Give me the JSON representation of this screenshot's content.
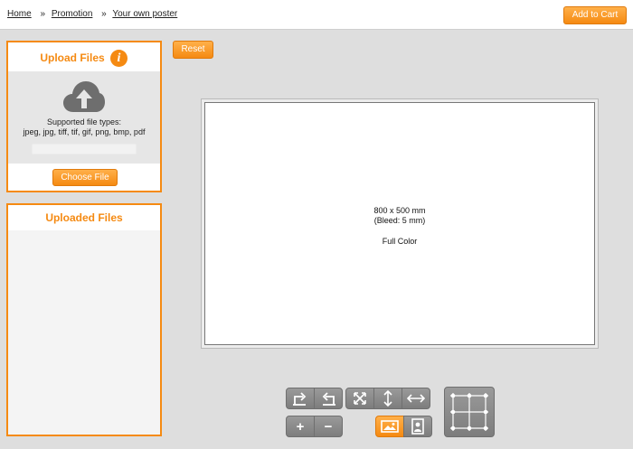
{
  "breadcrumb": {
    "items": [
      {
        "label": "Home"
      },
      {
        "label": "Promotion"
      },
      {
        "label": "Your own poster"
      }
    ],
    "separator": "»"
  },
  "header": {
    "add_to_cart": "Add to Cart"
  },
  "upload": {
    "title": "Upload Files",
    "info_glyph": "i",
    "supported_label": "Supported file types:",
    "types": "jpeg, jpg, tiff, tif, gif, png, bmp, pdf",
    "choose_label": "Choose File",
    "icon": "cloud-upload-icon"
  },
  "uploaded": {
    "title": "Uploaded Files"
  },
  "toolbar": {
    "reset_label": "Reset",
    "zoom_in": "+",
    "zoom_out": "−",
    "icons": [
      "rotate-right-icon",
      "rotate-left-icon",
      "fit-icon",
      "stretch-vertical-icon",
      "stretch-horizontal-icon",
      "landscape-icon",
      "portrait-icon",
      "alignment-grid-icon"
    ]
  },
  "canvas": {
    "size": "800 x 500 mm",
    "bleed": "(Bleed: 5 mm)",
    "color": "Full Color"
  },
  "colors": {
    "accent": "#f58a12",
    "tool_gray": "#8a8a8a",
    "background": "#dedede"
  }
}
